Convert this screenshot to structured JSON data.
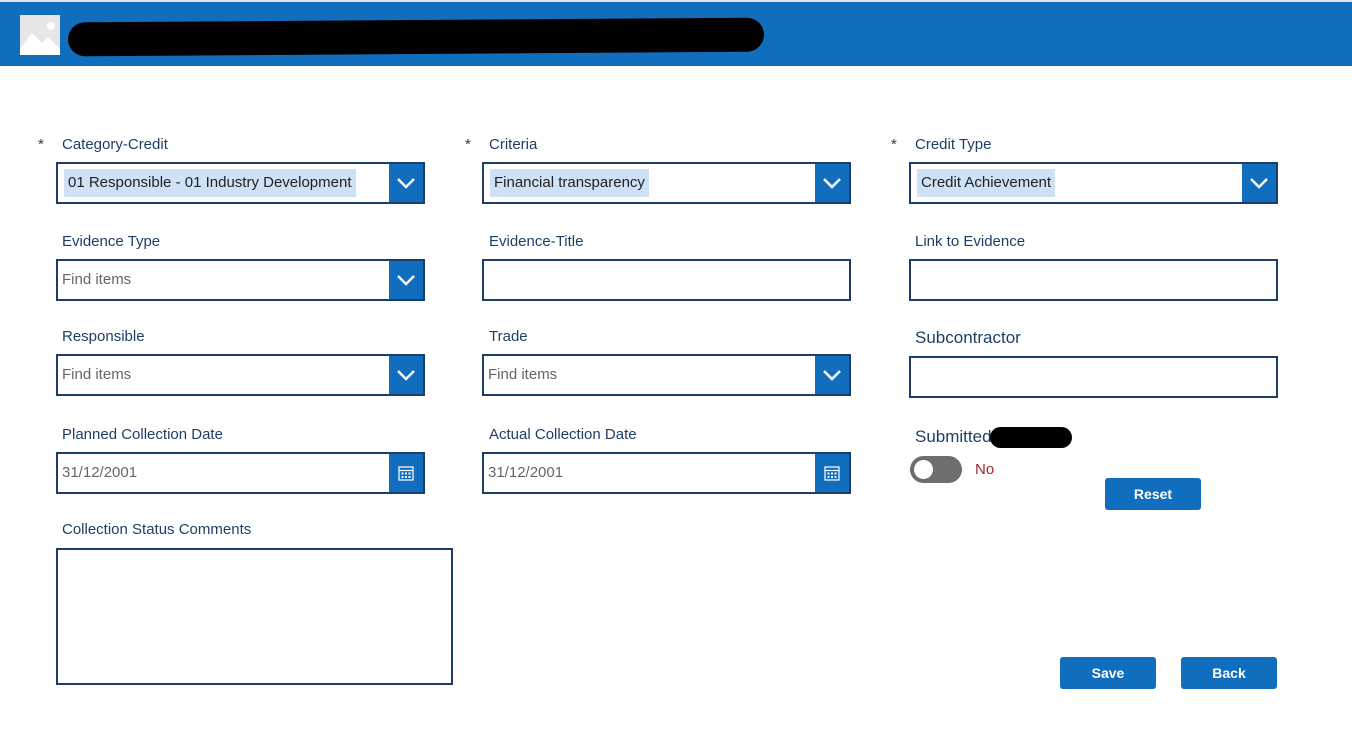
{
  "header": {
    "title": "",
    "logo_icon": "image-placeholder-icon",
    "background": "#116ebf"
  },
  "form": {
    "required_marker": "*",
    "category_credit": {
      "label": "Category-Credit",
      "value": "01 Responsible - 01 Industry Development"
    },
    "criteria": {
      "label": "Criteria",
      "value": "Financial transparency"
    },
    "credit_type": {
      "label": "Credit Type",
      "value": "Credit Achievement"
    },
    "evidence_type": {
      "label": "Evidence Type",
      "placeholder": "Find items"
    },
    "evidence_title": {
      "label": "Evidence-Title",
      "value": ""
    },
    "link_to_evidence": {
      "label": "Link to Evidence",
      "value": ""
    },
    "responsible": {
      "label": "Responsible",
      "placeholder": "Find items"
    },
    "trade": {
      "label": "Trade",
      "placeholder": "Find items"
    },
    "subcontractor": {
      "label": "Subcontractor",
      "value": ""
    },
    "planned_collection_date": {
      "label": "Planned Collection Date",
      "value": "31/12/2001"
    },
    "actual_collection_date": {
      "label": "Actual Collection Date",
      "value": "31/12/2001"
    },
    "submitted": {
      "label": "Submitted",
      "toggle_text": "No",
      "checked": false
    },
    "collection_status_comments": {
      "label": "Collection Status Comments",
      "value": ""
    }
  },
  "buttons": {
    "reset": "Reset",
    "save": "Save",
    "back": "Back"
  },
  "colors": {
    "accent": "#116ebf",
    "border": "#1f3e67",
    "selection": "#cfe1f7",
    "toggle_off_text": "#a4262c"
  }
}
